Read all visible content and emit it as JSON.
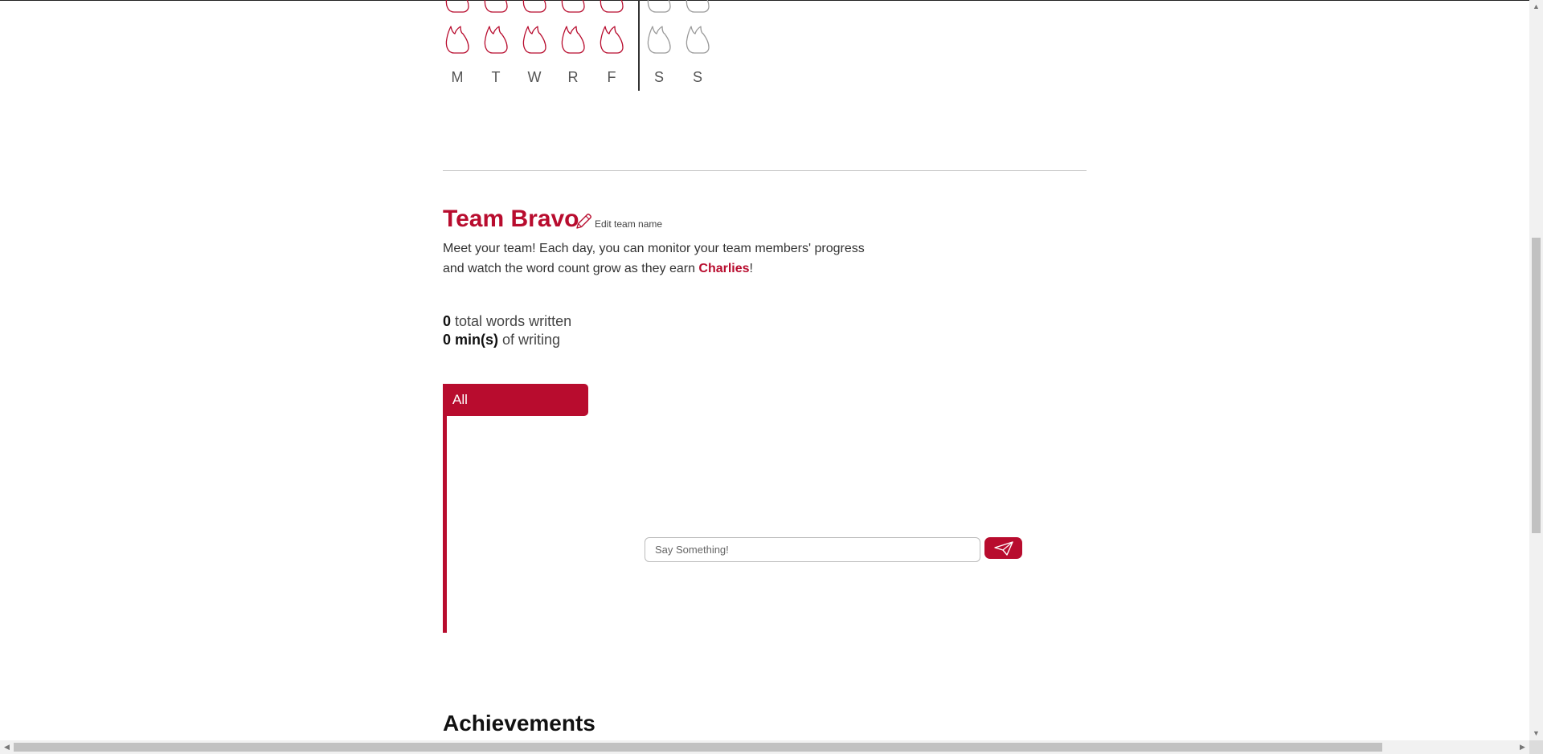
{
  "week": {
    "days": [
      {
        "label": "M",
        "earned": true
      },
      {
        "label": "T",
        "earned": true
      },
      {
        "label": "W",
        "earned": true
      },
      {
        "label": "R",
        "earned": true
      },
      {
        "label": "F",
        "earned": true
      },
      {
        "label": "S",
        "earned": false
      },
      {
        "label": "S",
        "earned": false
      }
    ]
  },
  "team": {
    "name": "Team Bravo",
    "edit_label": "Edit team name",
    "intro_before": "Meet your team! Each day, you can monitor your team members' progress and watch the word count grow as they earn ",
    "intro_brand": "Charlies",
    "intro_after": "!"
  },
  "stats": {
    "words_value": "0",
    "words_label": "total words written",
    "minutes_value": "0 min(s)",
    "minutes_label": "of writing"
  },
  "tabs": {
    "all_label": "All"
  },
  "chat": {
    "placeholder": "Say Something!"
  },
  "achievements": {
    "title": "Achievements"
  },
  "colors": {
    "accent": "#b80c2e",
    "inactive_wing": "#9a9a9a"
  }
}
